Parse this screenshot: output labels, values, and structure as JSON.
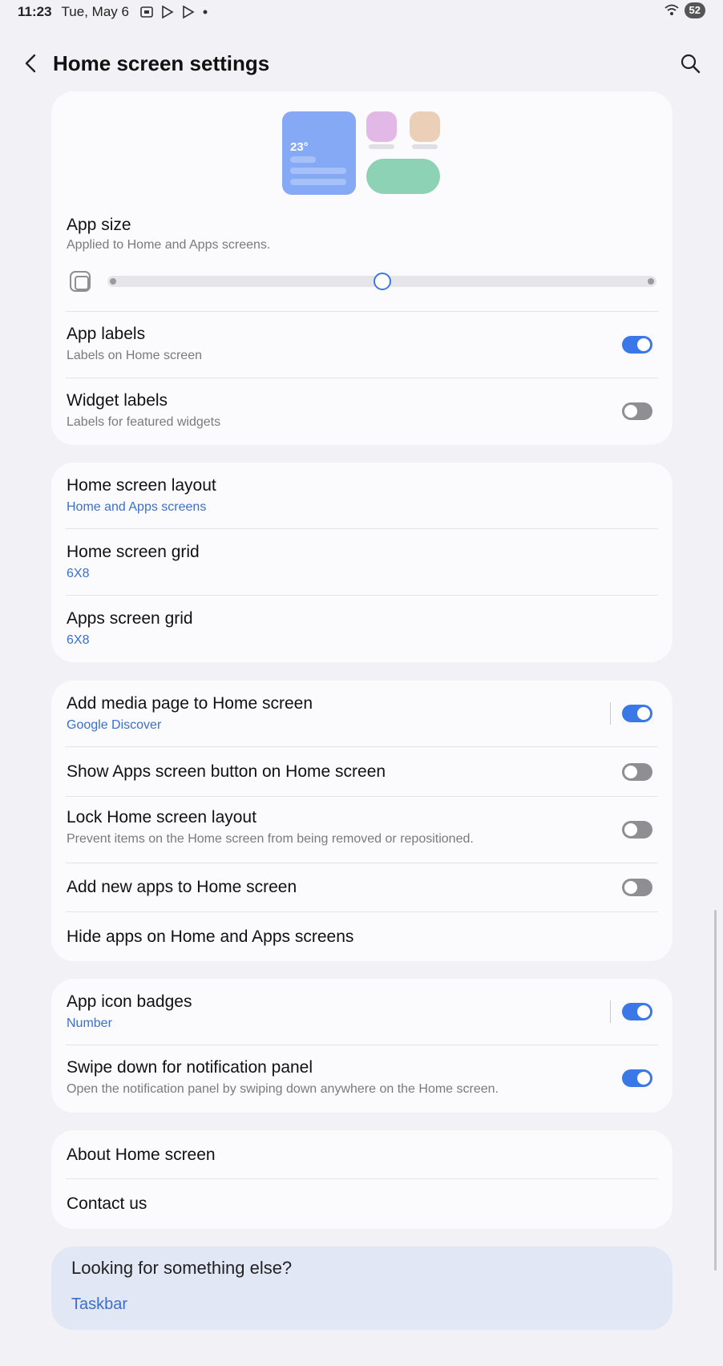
{
  "status": {
    "time": "11:23",
    "date": "Tue, May 6",
    "battery": "52"
  },
  "header": {
    "title": "Home screen settings"
  },
  "app_size": {
    "title": "App size",
    "subtitle": "Applied to Home and Apps screens.",
    "widget_temp": "23°",
    "slider_value_fraction": 0.5
  },
  "group1": {
    "app_labels": {
      "title": "App labels",
      "subtitle": "Labels on Home screen",
      "on": true
    },
    "widget_labels": {
      "title": "Widget labels",
      "subtitle": "Labels for featured widgets",
      "on": false
    }
  },
  "group2": {
    "layout": {
      "title": "Home screen layout",
      "value": "Home and Apps screens"
    },
    "home_grid": {
      "title": "Home screen grid",
      "value": "6X8"
    },
    "apps_grid": {
      "title": "Apps screen grid",
      "value": "6X8"
    }
  },
  "group3": {
    "media_page": {
      "title": "Add media page to Home screen",
      "value": "Google Discover",
      "on": true
    },
    "apps_button": {
      "title": "Show Apps screen button on Home screen",
      "on": false
    },
    "lock_layout": {
      "title": "Lock Home screen layout",
      "subtitle": "Prevent items on the Home screen from being removed or repositioned.",
      "on": false
    },
    "add_new_apps": {
      "title": "Add new apps to Home screen",
      "on": false
    },
    "hide_apps": {
      "title": "Hide apps on Home and Apps screens"
    }
  },
  "group4": {
    "badges": {
      "title": "App icon badges",
      "value": "Number",
      "on": true
    },
    "swipe_down": {
      "title": "Swipe down for notification panel",
      "subtitle": "Open the notification panel by swiping down anywhere on the Home screen.",
      "on": true
    }
  },
  "group5": {
    "about": {
      "title": "About Home screen"
    },
    "contact": {
      "title": "Contact us"
    }
  },
  "looking_else": {
    "title": "Looking for something else?",
    "link": "Taskbar"
  },
  "colors": {
    "accent": "#3a78e8",
    "link": "#3a70c8",
    "toggle_off": "#8e8e93",
    "widget_blue": "#85a9f5",
    "widget_purple": "#e2b9e6",
    "widget_peach": "#ebcfb6",
    "widget_green": "#8ed2b6"
  }
}
